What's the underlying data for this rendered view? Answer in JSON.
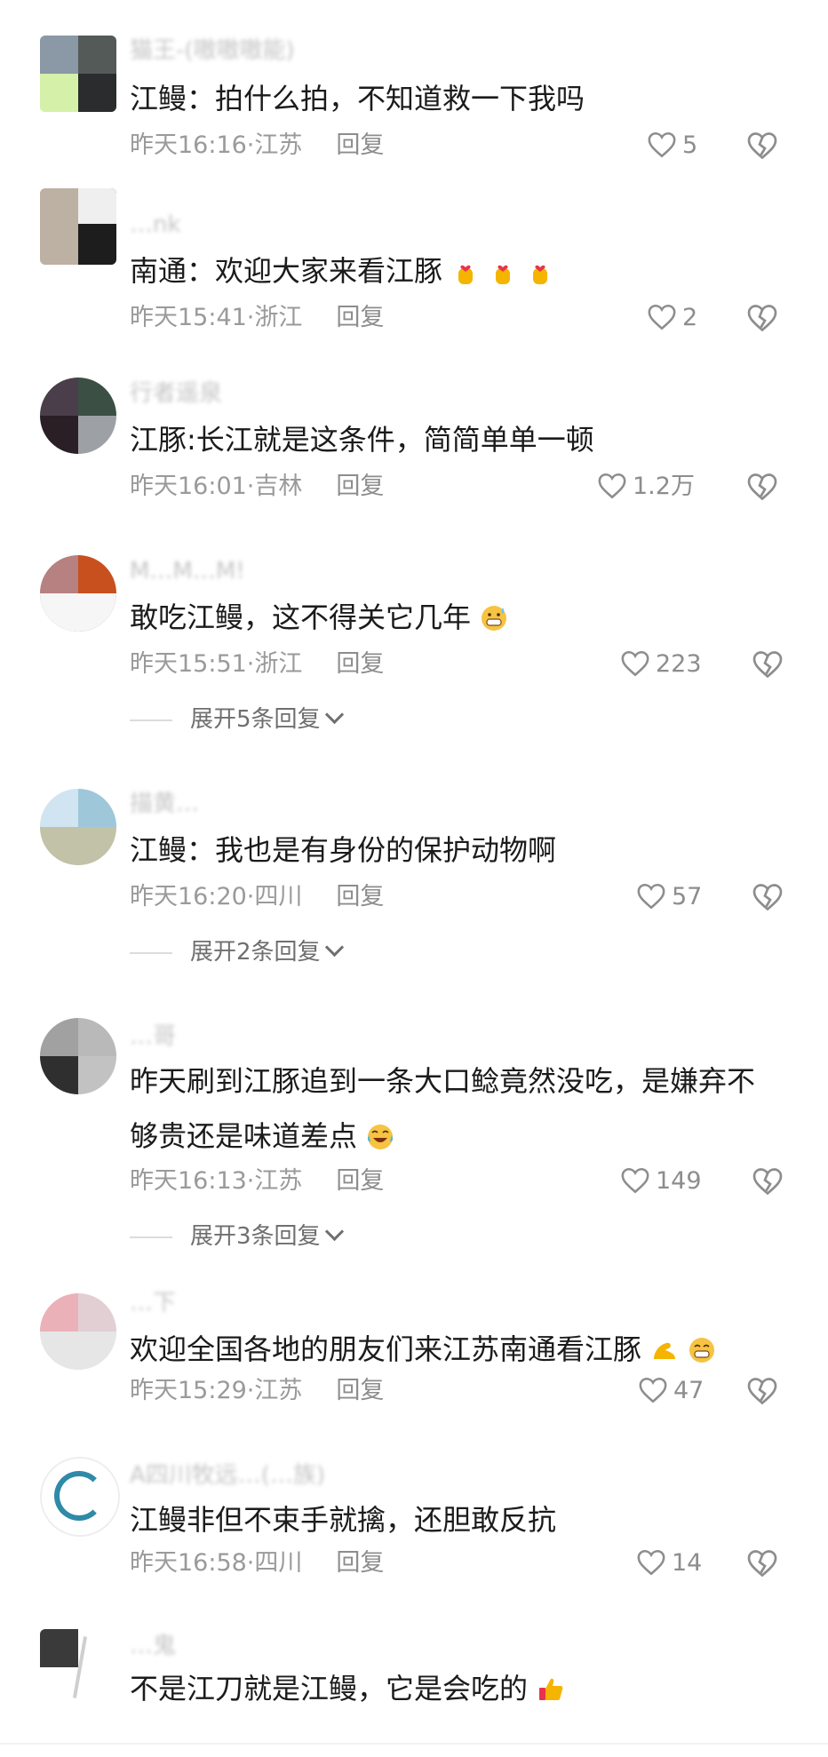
{
  "comments": [
    {
      "user": "猫王-(嗷嗷嗷能)",
      "text": "江鳗：拍什么拍，不知道救一下我吗",
      "emoji": [],
      "time": "昨天16:16·江苏",
      "reply": "回复",
      "likes": "5"
    },
    {
      "user": "…nk",
      "text": "南通：欢迎大家来看江豚",
      "emoji": [
        "hand-heart-emoji",
        "hand-heart-emoji",
        "hand-heart-emoji"
      ],
      "time": "昨天15:41·浙江",
      "reply": "回复",
      "likes": "2"
    },
    {
      "user": "行者遥泉",
      "text": "江豚:长江就是这条件，简简单单一顿",
      "emoji": [],
      "time": "昨天16:01·吉林",
      "reply": "回复",
      "likes": "1.2万"
    },
    {
      "user": "M…M…M!",
      "text": "敢吃江鳗，这不得关它几年",
      "emoji": [
        "grimace-sweat-emoji"
      ],
      "time": "昨天15:51·浙江",
      "reply": "回复",
      "likes": "223",
      "expand": "展开5条回复"
    },
    {
      "user": "描黄…",
      "text": "江鳗：我也是有身份的保护动物啊",
      "emoji": [],
      "time": "昨天16:20·四川",
      "reply": "回复",
      "likes": "57",
      "expand": "展开2条回复"
    },
    {
      "user": "…哥",
      "text": "昨天刷到江豚追到一条大口鲶竟然没吃，是嫌弃不够贵还是味道差点",
      "emoji": [
        "laugh-cry-emoji"
      ],
      "time": "昨天16:13·江苏",
      "reply": "回复",
      "likes": "149",
      "expand": "展开3条回复"
    },
    {
      "user": "…下",
      "text": "欢迎全国各地的朋友们来江苏南通看江豚",
      "emoji": [
        "flex-arm-emoji",
        "grin-emoji"
      ],
      "time": "昨天15:29·江苏",
      "reply": "回复",
      "likes": "47"
    },
    {
      "user": "A四川牧远…(…族)",
      "text": "江鳗非但不束手就擒，还胆敢反抗",
      "emoji": [],
      "time": "昨天16:58·四川",
      "reply": "回复",
      "likes": "14"
    },
    {
      "user": "…鬼",
      "text": "不是江刀就是江鳗，它是会吃的",
      "emoji": [
        "thumbs-up-emoji"
      ],
      "time": "",
      "reply": "",
      "likes": ""
    }
  ],
  "colors": {
    "heart": "#8d8d8d",
    "meta": "#9a9a9a",
    "text": "#1b1b1b",
    "background": "#ffffff"
  },
  "icons": {
    "like": "heart-outline-icon",
    "dislike": "broken-heart-icon",
    "expand": "chevron-down-icon"
  }
}
